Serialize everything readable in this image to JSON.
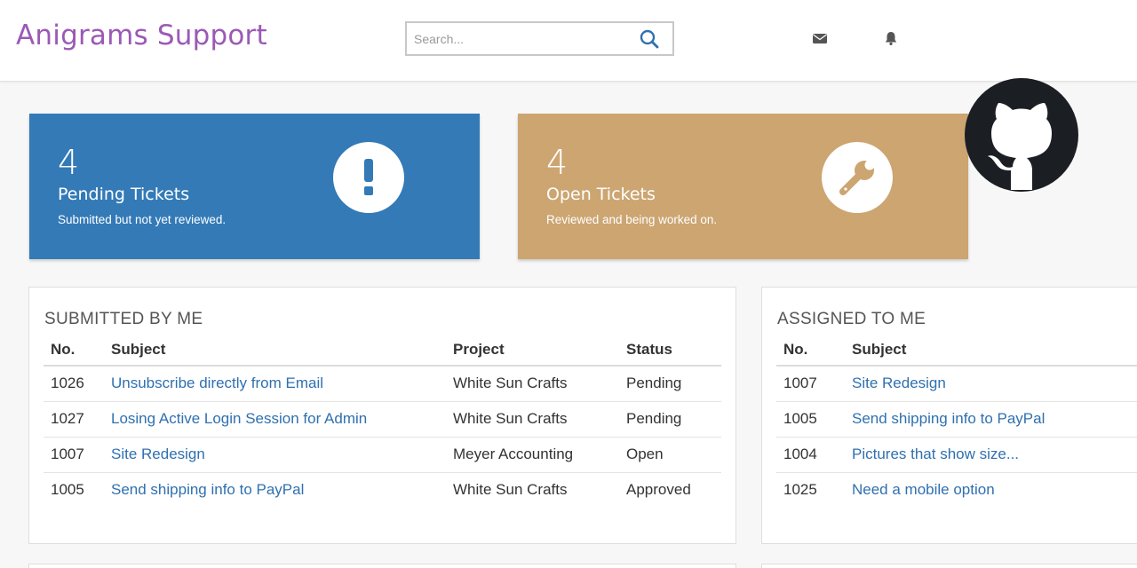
{
  "header": {
    "brand": "Anigrams Support",
    "search_placeholder": "Search...",
    "icons": {
      "search": "search-icon",
      "mail": "envelope-icon",
      "notifications": "bell-icon"
    },
    "brand_color": "#9b59b6"
  },
  "stats": [
    {
      "count": "4",
      "title": "Pending Tickets",
      "description": "Submitted but not yet reviewed.",
      "icon": "exclamation-icon",
      "color": "#337ab7"
    },
    {
      "count": "4",
      "title": "Open Tickets",
      "description": "Reviewed and being worked on.",
      "icon": "wrench-icon",
      "color": "#cca571"
    }
  ],
  "submitted": {
    "title": "SUBMITTED BY ME",
    "columns": [
      "No.",
      "Subject",
      "Project",
      "Status"
    ],
    "rows": [
      {
        "no": "1026",
        "subject": "Unsubscribe directly from Email",
        "project": "White Sun Crafts",
        "status": "Pending"
      },
      {
        "no": "1027",
        "subject": "Losing Active Login Session for Admin",
        "project": "White Sun Crafts",
        "status": "Pending"
      },
      {
        "no": "1007",
        "subject": "Site Redesign",
        "project": "Meyer Accounting",
        "status": "Open"
      },
      {
        "no": "1005",
        "subject": "Send shipping info to PayPal",
        "project": "White Sun Crafts",
        "status": "Approved"
      }
    ]
  },
  "assigned": {
    "title": "ASSIGNED TO ME",
    "columns": [
      "No.",
      "Subject"
    ],
    "rows": [
      {
        "no": "1007",
        "subject": "Site Redesign"
      },
      {
        "no": "1005",
        "subject": "Send shipping info to PayPal"
      },
      {
        "no": "1004",
        "subject": "Pictures that show size..."
      },
      {
        "no": "1025",
        "subject": "Need a mobile option"
      }
    ]
  },
  "corner_icon": "github-icon",
  "link_color": "#2f70b0"
}
